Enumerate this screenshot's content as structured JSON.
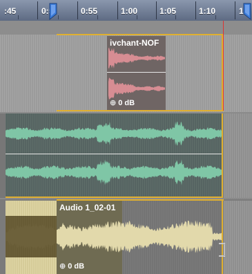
{
  "ruler": {
    "labels": [
      ":45",
      "0:5",
      "0:55",
      "1:00",
      "1:05",
      "1:10",
      "1:"
    ]
  },
  "clips": {
    "pink": {
      "title": "ivchant-NOF",
      "gain": "0 dB",
      "color": "#d78d93"
    },
    "green": {
      "color": "#7fc6a6"
    },
    "audio": {
      "title": "Audio 1_02-01",
      "gain": "0 dB",
      "color": "#e2d9ab"
    }
  },
  "colors": {
    "selection": "#e0b030",
    "playhead": "#dd3333",
    "marker": "#3b7bd8"
  }
}
